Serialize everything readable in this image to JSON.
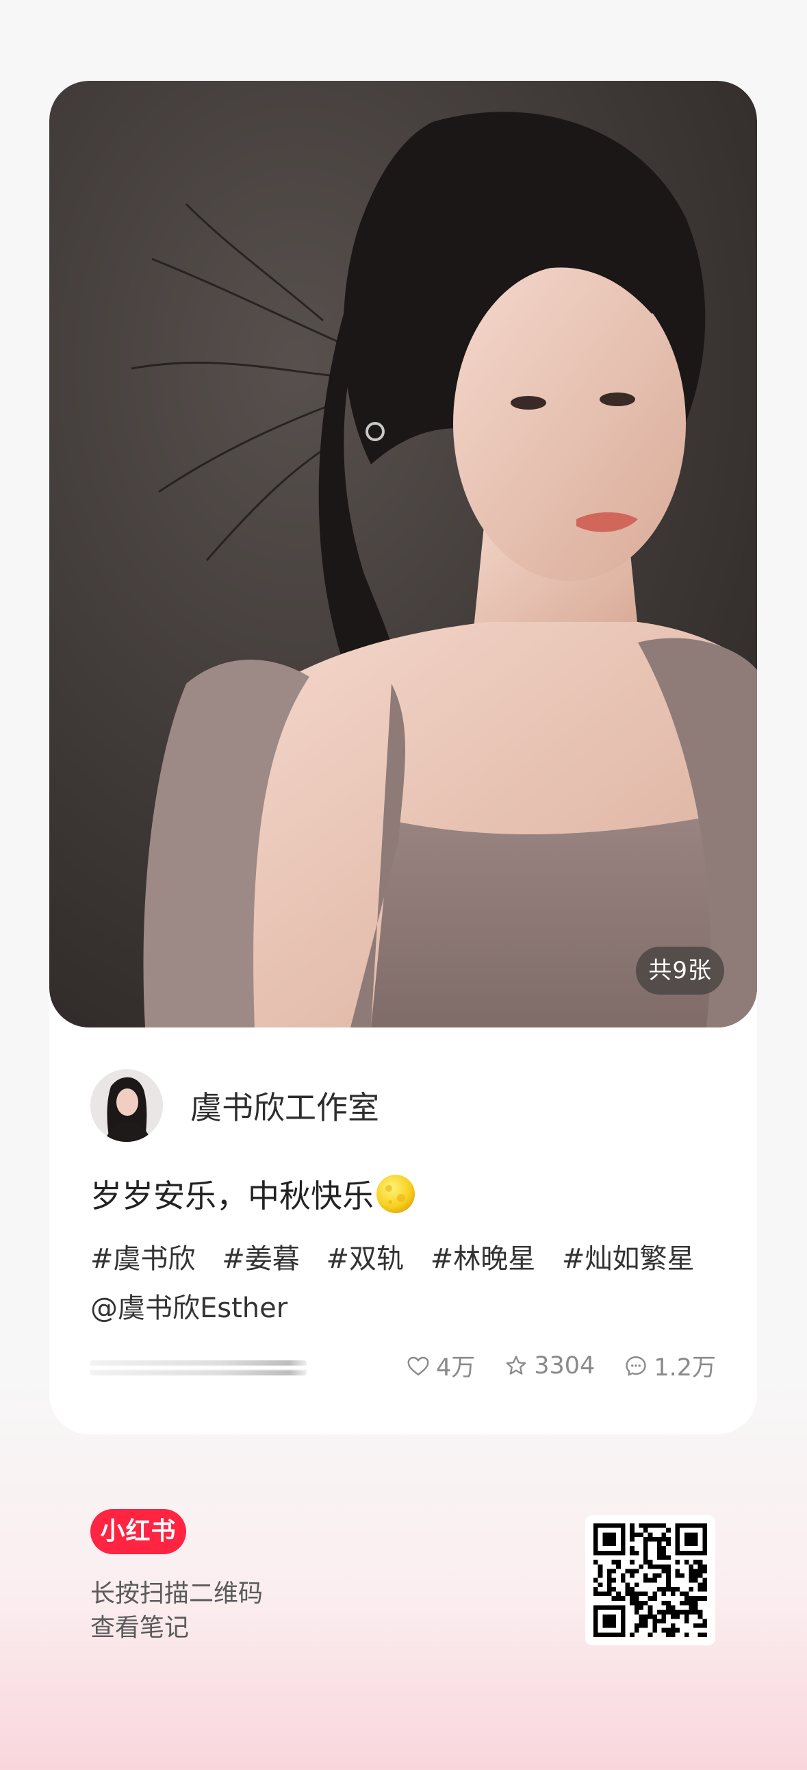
{
  "post": {
    "image_count_label": "共9张",
    "author_name": "虞书欣工作室",
    "title": "岁岁安乐，中秋快乐",
    "title_emoji": "full-moon-emoji",
    "tags": [
      "#虞书欣",
      "#姜暮",
      "#双轨",
      "#林晚星",
      "#灿如繁星"
    ],
    "mention": "@虞书欣Esther",
    "stats": {
      "likes": "4万",
      "favorites": "3304",
      "comments": "1.2万"
    }
  },
  "footer": {
    "logo_text": "小红书",
    "scan_hint_line1": "长按扫描二维码",
    "scan_hint_line2": "查看笔记"
  },
  "colors": {
    "brand_red": "#ff2442",
    "background": "#f7f7f7",
    "bottom_gradient_pink": "#f9d6dc",
    "text_primary": "#222222",
    "text_secondary": "#8a8a8a"
  },
  "icons": {
    "like": "heart-outline-icon",
    "favorite": "star-outline-icon",
    "comment": "chat-bubble-icon"
  }
}
